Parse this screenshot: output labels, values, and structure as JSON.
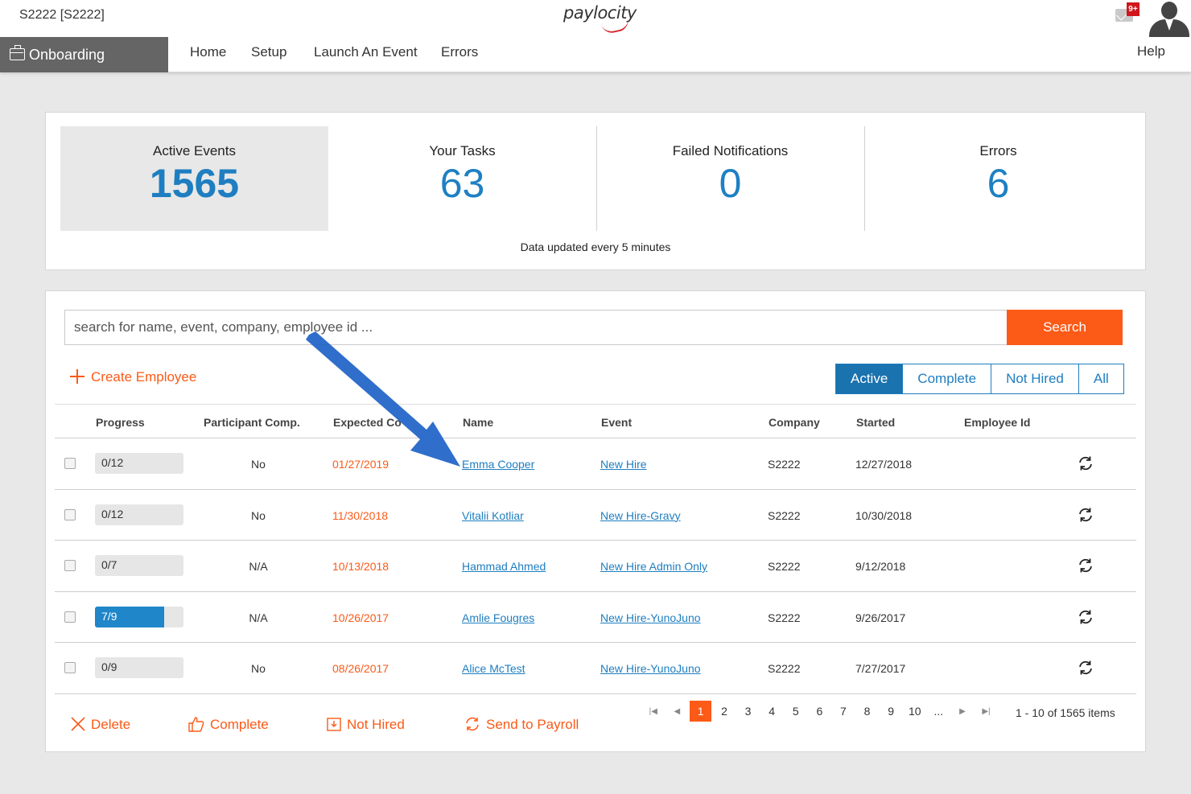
{
  "topbar": {
    "company": "S2222 [S2222]",
    "logo": "paylocity",
    "badge": "9+",
    "mail_icon": "mail-icon",
    "avatar_icon": "user-avatar-icon"
  },
  "nav": {
    "brand": "Onboarding",
    "items": [
      "Home",
      "Setup",
      "Launch An Event",
      "Errors"
    ],
    "help": "Help"
  },
  "stats": {
    "cards": [
      {
        "label": "Active Events",
        "value": "1565",
        "active": true
      },
      {
        "label": "Your Tasks",
        "value": "63"
      },
      {
        "label": "Failed Notifications",
        "value": "0"
      },
      {
        "label": "Errors",
        "value": "6"
      }
    ],
    "updated": "Data updated every 5 minutes"
  },
  "search": {
    "placeholder": "search for name, event, company, employee id ...",
    "button": "Search"
  },
  "create_employee": "Create Employee",
  "filters": [
    "Active",
    "Complete",
    "Not Hired",
    "All"
  ],
  "table": {
    "headers": [
      "Progress",
      "Participant Comp.",
      "Expected Co",
      "Name",
      "Event",
      "Company",
      "Started",
      "Employee Id"
    ],
    "rows": [
      {
        "progress": "0/12",
        "progress_fraction": 0,
        "participant": "No",
        "expected": "01/27/2019",
        "name": "Emma Cooper",
        "event": "New Hire",
        "company": "S2222",
        "started": "12/27/2018",
        "employee_id": ""
      },
      {
        "progress": "0/12",
        "progress_fraction": 0,
        "participant": "No",
        "expected": "11/30/2018",
        "name": "Vitalii Kotliar",
        "event": "New Hire-Gravy",
        "company": "S2222",
        "started": "10/30/2018",
        "employee_id": ""
      },
      {
        "progress": "0/7",
        "progress_fraction": 0,
        "participant": "N/A",
        "expected": "10/13/2018",
        "name": "Hammad Ahmed",
        "event": "New Hire Admin Only",
        "company": "S2222",
        "started": "9/12/2018",
        "employee_id": ""
      },
      {
        "progress": "7/9",
        "progress_fraction": 0.778,
        "participant": "N/A",
        "expected": "10/26/2017",
        "name": "Amlie Fougres",
        "event": "New Hire-YunoJuno",
        "company": "S2222",
        "started": "9/26/2017",
        "employee_id": ""
      },
      {
        "progress": "0/9",
        "progress_fraction": 0,
        "participant": "No",
        "expected": "08/26/2017",
        "name": "Alice McTest",
        "event": "New Hire-YunoJuno",
        "company": "S2222",
        "started": "7/27/2017",
        "employee_id": ""
      }
    ]
  },
  "actions": [
    "Delete",
    "Complete",
    "Not Hired",
    "Send to Payroll"
  ],
  "pager": {
    "pages": [
      "1",
      "2",
      "3",
      "4",
      "5",
      "6",
      "7",
      "8",
      "9",
      "10",
      "..."
    ],
    "current": "1",
    "summary": "1 - 10 of 1565 items"
  },
  "colors": {
    "accent": "#fb5a17",
    "primary": "#1e7ec0",
    "nav_brand_bg": "#656565"
  }
}
